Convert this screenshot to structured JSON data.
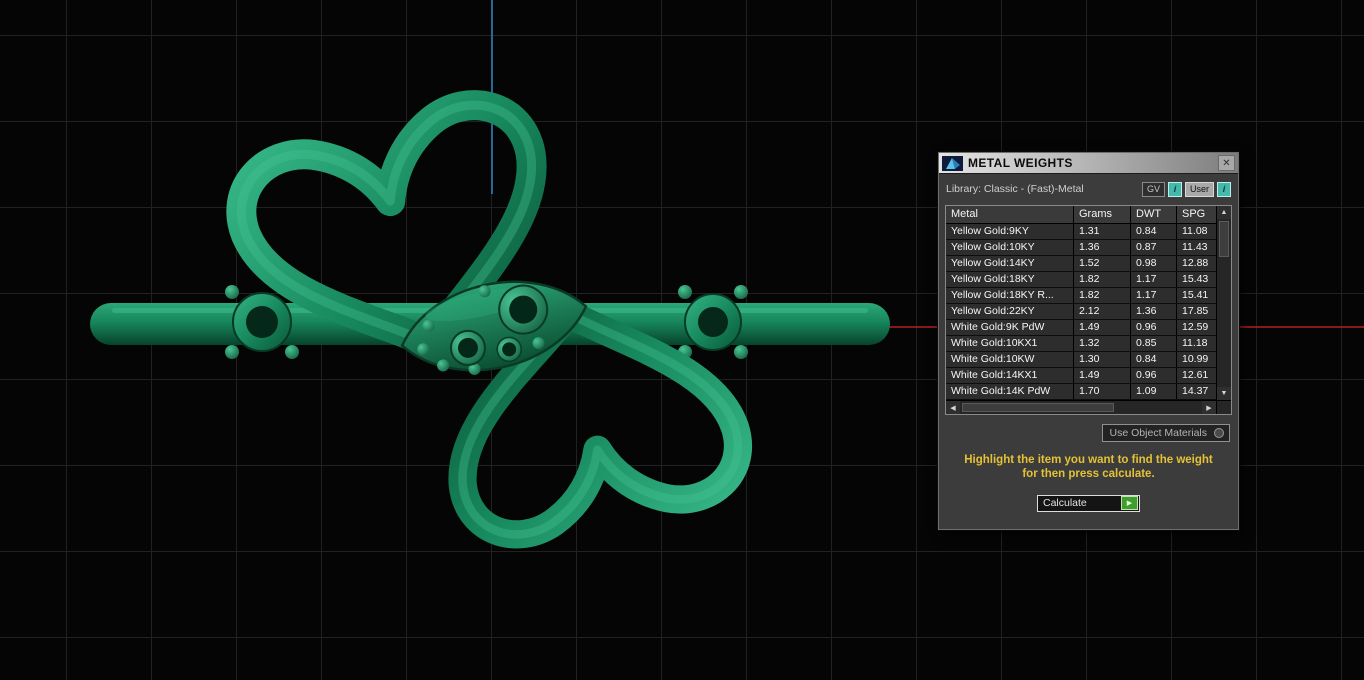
{
  "colors": {
    "model_green": "#1d8a60",
    "axis_vertical": "#2e86c0",
    "axis_horizontal": "#b32020",
    "accent_teal": "#45b8ac",
    "instruction_yellow": "#e5c235",
    "calculate_green": "#3f9e2d"
  },
  "icons": {
    "close": "✕",
    "info": "i",
    "scroll_up": "▲",
    "scroll_down": "▼",
    "scroll_left": "◀",
    "scroll_right": "▶",
    "play": "▶"
  },
  "dialog": {
    "title": "METAL WEIGHTS",
    "library_label": "Library: Classic - (Fast)-Metal",
    "gv_button": {
      "label": "GV"
    },
    "user_button": {
      "label": "User"
    },
    "table": {
      "columns": [
        {
          "label": "Metal"
        },
        {
          "label": "Grams"
        },
        {
          "label": "DWT"
        },
        {
          "label": "SPG"
        }
      ],
      "rows": [
        {
          "metal": "Yellow Gold:9KY",
          "grams": "1.31",
          "dwt": "0.84",
          "spg": "11.08"
        },
        {
          "metal": "Yellow Gold:10KY",
          "grams": "1.36",
          "dwt": "0.87",
          "spg": "11.43"
        },
        {
          "metal": "Yellow Gold:14KY",
          "grams": "1.52",
          "dwt": "0.98",
          "spg": "12.88"
        },
        {
          "metal": "Yellow Gold:18KY",
          "grams": "1.82",
          "dwt": "1.17",
          "spg": "15.43"
        },
        {
          "metal": "Yellow Gold:18KY R...",
          "grams": "1.82",
          "dwt": "1.17",
          "spg": "15.41"
        },
        {
          "metal": "Yellow Gold:22KY",
          "grams": "2.12",
          "dwt": "1.36",
          "spg": "17.85"
        },
        {
          "metal": "White Gold:9K PdW",
          "grams": "1.49",
          "dwt": "0.96",
          "spg": "12.59"
        },
        {
          "metal": "White Gold:10KX1",
          "grams": "1.32",
          "dwt": "0.85",
          "spg": "11.18"
        },
        {
          "metal": "White Gold:10KW",
          "grams": "1.30",
          "dwt": "0.84",
          "spg": "10.99"
        },
        {
          "metal": "White Gold:14KX1",
          "grams": "1.49",
          "dwt": "0.96",
          "spg": "12.61"
        },
        {
          "metal": "White Gold:14K PdW",
          "grams": "1.70",
          "dwt": "1.09",
          "spg": "14.37"
        }
      ]
    },
    "use_object_materials_label": "Use Object Materials",
    "instruction": "Highlight the item you want to find the weight\nfor then press calculate.",
    "calculate_label": "Calculate"
  }
}
